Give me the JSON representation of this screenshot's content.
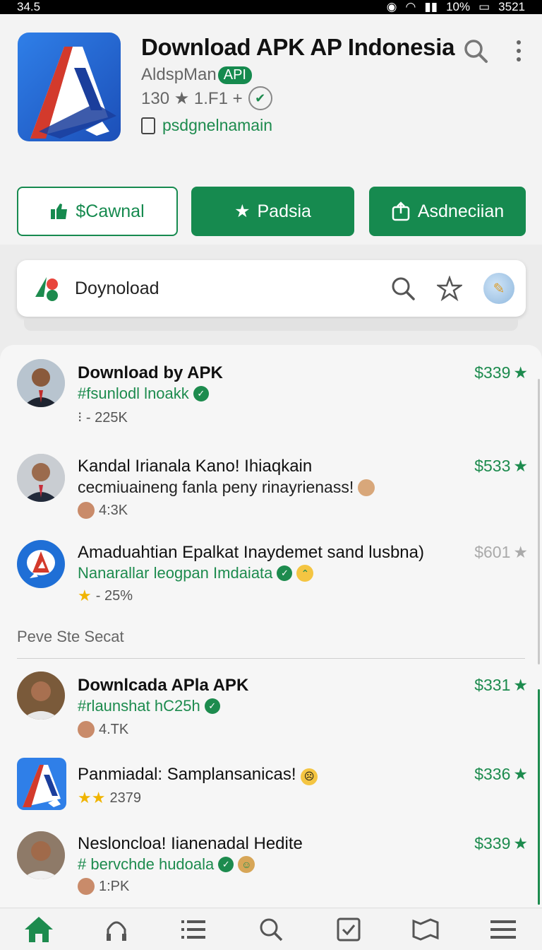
{
  "statusbar": {
    "time": "34.5",
    "battery": "10%",
    "right_num": "3521"
  },
  "app": {
    "title": "Download APK AP Indonesia",
    "developer": "AldspMan",
    "badge": "API",
    "rating": "130 ★ 1.F1 +",
    "package": "psdgnelnamain"
  },
  "buttons": [
    {
      "label": "$Cawnal"
    },
    {
      "label": "Padsia"
    },
    {
      "label": "Asdneciian"
    }
  ],
  "search": {
    "label": "Doynoload"
  },
  "list": [
    {
      "title": "Download by APK",
      "subtitle": "#fsunlodl lnoakk",
      "meta": "⁝ - 225K",
      "price": "$339"
    },
    {
      "title": "Kandal Irianala Kano! Ihiaqkain",
      "subtitle": "cecmiuaineng fanla peny rinayrienass!",
      "meta": "4:3K",
      "price": "$533"
    },
    {
      "title": "Amaduahtian Epalkat Inaydemet sand lusbna)",
      "subtitle": "Nanarallar leogpan Imdaiata",
      "meta": "- 25%",
      "price": "$601"
    }
  ],
  "section_title": "Peve Ste Secat",
  "list2": [
    {
      "title": "Downlcada APla APK",
      "subtitle": "#rlaunshat hC25h",
      "meta": "4.TK",
      "price": "$331"
    },
    {
      "title": "Panmiadal: Samplansanicas!",
      "meta": "2379",
      "price": "$336"
    },
    {
      "title": "Nesloncloa! Iianenadal Hedite",
      "subtitle": "# bervchde hudoala",
      "meta": "1:PK",
      "price": "$339"
    }
  ],
  "colors": {
    "accent": "#168a4f",
    "background": "#f3f3f3"
  }
}
